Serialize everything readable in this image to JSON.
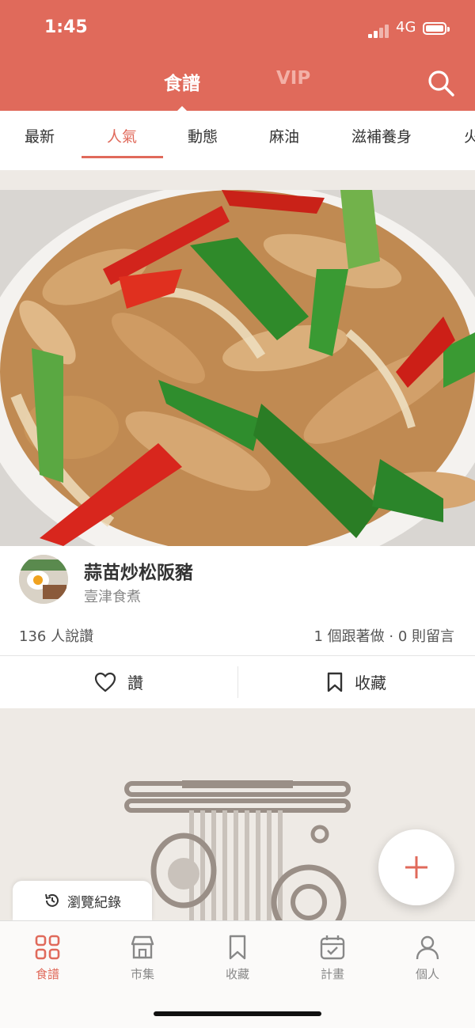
{
  "status_bar": {
    "time": "1:45",
    "network": "4G"
  },
  "header": {
    "tabs": [
      "食譜",
      "VIP"
    ],
    "active_tab": "食譜"
  },
  "categories": [
    "最新",
    "人氣",
    "動態",
    "麻油",
    "滋補養身",
    "火"
  ],
  "active_category": "人氣",
  "recipe": {
    "title": "蒜苗炒松阪豬",
    "author": "壹津食煮",
    "likes": "136 人說讚",
    "stats": "1 個跟著做 · 0 則留言",
    "like_label": "讚",
    "save_label": "收藏"
  },
  "history_label": "瀏覽紀錄",
  "bottom_nav": [
    {
      "label": "食譜",
      "icon": "grid-icon",
      "active": true
    },
    {
      "label": "市集",
      "icon": "store-icon",
      "active": false
    },
    {
      "label": "收藏",
      "icon": "bookmark-icon",
      "active": false
    },
    {
      "label": "計畫",
      "icon": "calendar-check-icon",
      "active": false
    },
    {
      "label": "個人",
      "icon": "person-icon",
      "active": false
    }
  ],
  "colors": {
    "accent": "#e06a5b",
    "background": "#eeeae5"
  }
}
